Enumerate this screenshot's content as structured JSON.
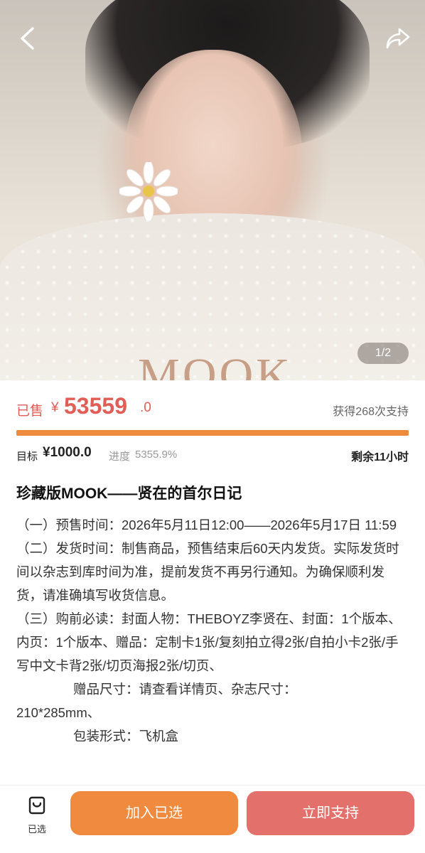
{
  "hero": {
    "cover_text": "MOOK",
    "pager": "1/2"
  },
  "sales": {
    "sold_label": "已售",
    "currency": "¥",
    "amount_int": "53559",
    "amount_dec": ".0",
    "support_count": "获得268次支持",
    "progress_fraction": 1.0
  },
  "stats": {
    "goal_label": "目标",
    "goal_value": "¥1000.0",
    "progress_label": "进度",
    "progress_value": "5355.9%",
    "time_left": "剩余11小时"
  },
  "product": {
    "title": "珍藏版MOOK——贤在的首尔日记",
    "presale": "（一）预售时间：2026年5月11日12:00——2026年5月17日 11:59",
    "shipping": "（二）发货时间：制售商品，预售结束后60天内发货。实际发货时间以杂志到库时间为准，提前发货不再另行通知。为确保顺利发货，请准确填写收货信息。",
    "notice": "（三）购前必读：封面人物：THEBOYZ李贤在、封面：1个版本、内页：1个版本、赠品：定制卡1张/复刻拍立得2张/自拍小卡2张/手写中文卡背2张/切页海报2张/切页、",
    "gift_size": "赠品尺寸：请查看详情页、杂志尺寸：",
    "mag_size": "210*285mm、",
    "packaging": "包装形式：飞机盒"
  },
  "bottom": {
    "selected_label": "已选",
    "add_button": "加入已选",
    "support_button": "立即支持"
  },
  "colors": {
    "accent_red": "#e15d55",
    "accent_orange": "#ef8a3e",
    "button_red": "#e4706b"
  },
  "icons": {
    "back": "chevron-left-icon",
    "share": "share-arrow-icon",
    "selected": "bag-icon"
  }
}
